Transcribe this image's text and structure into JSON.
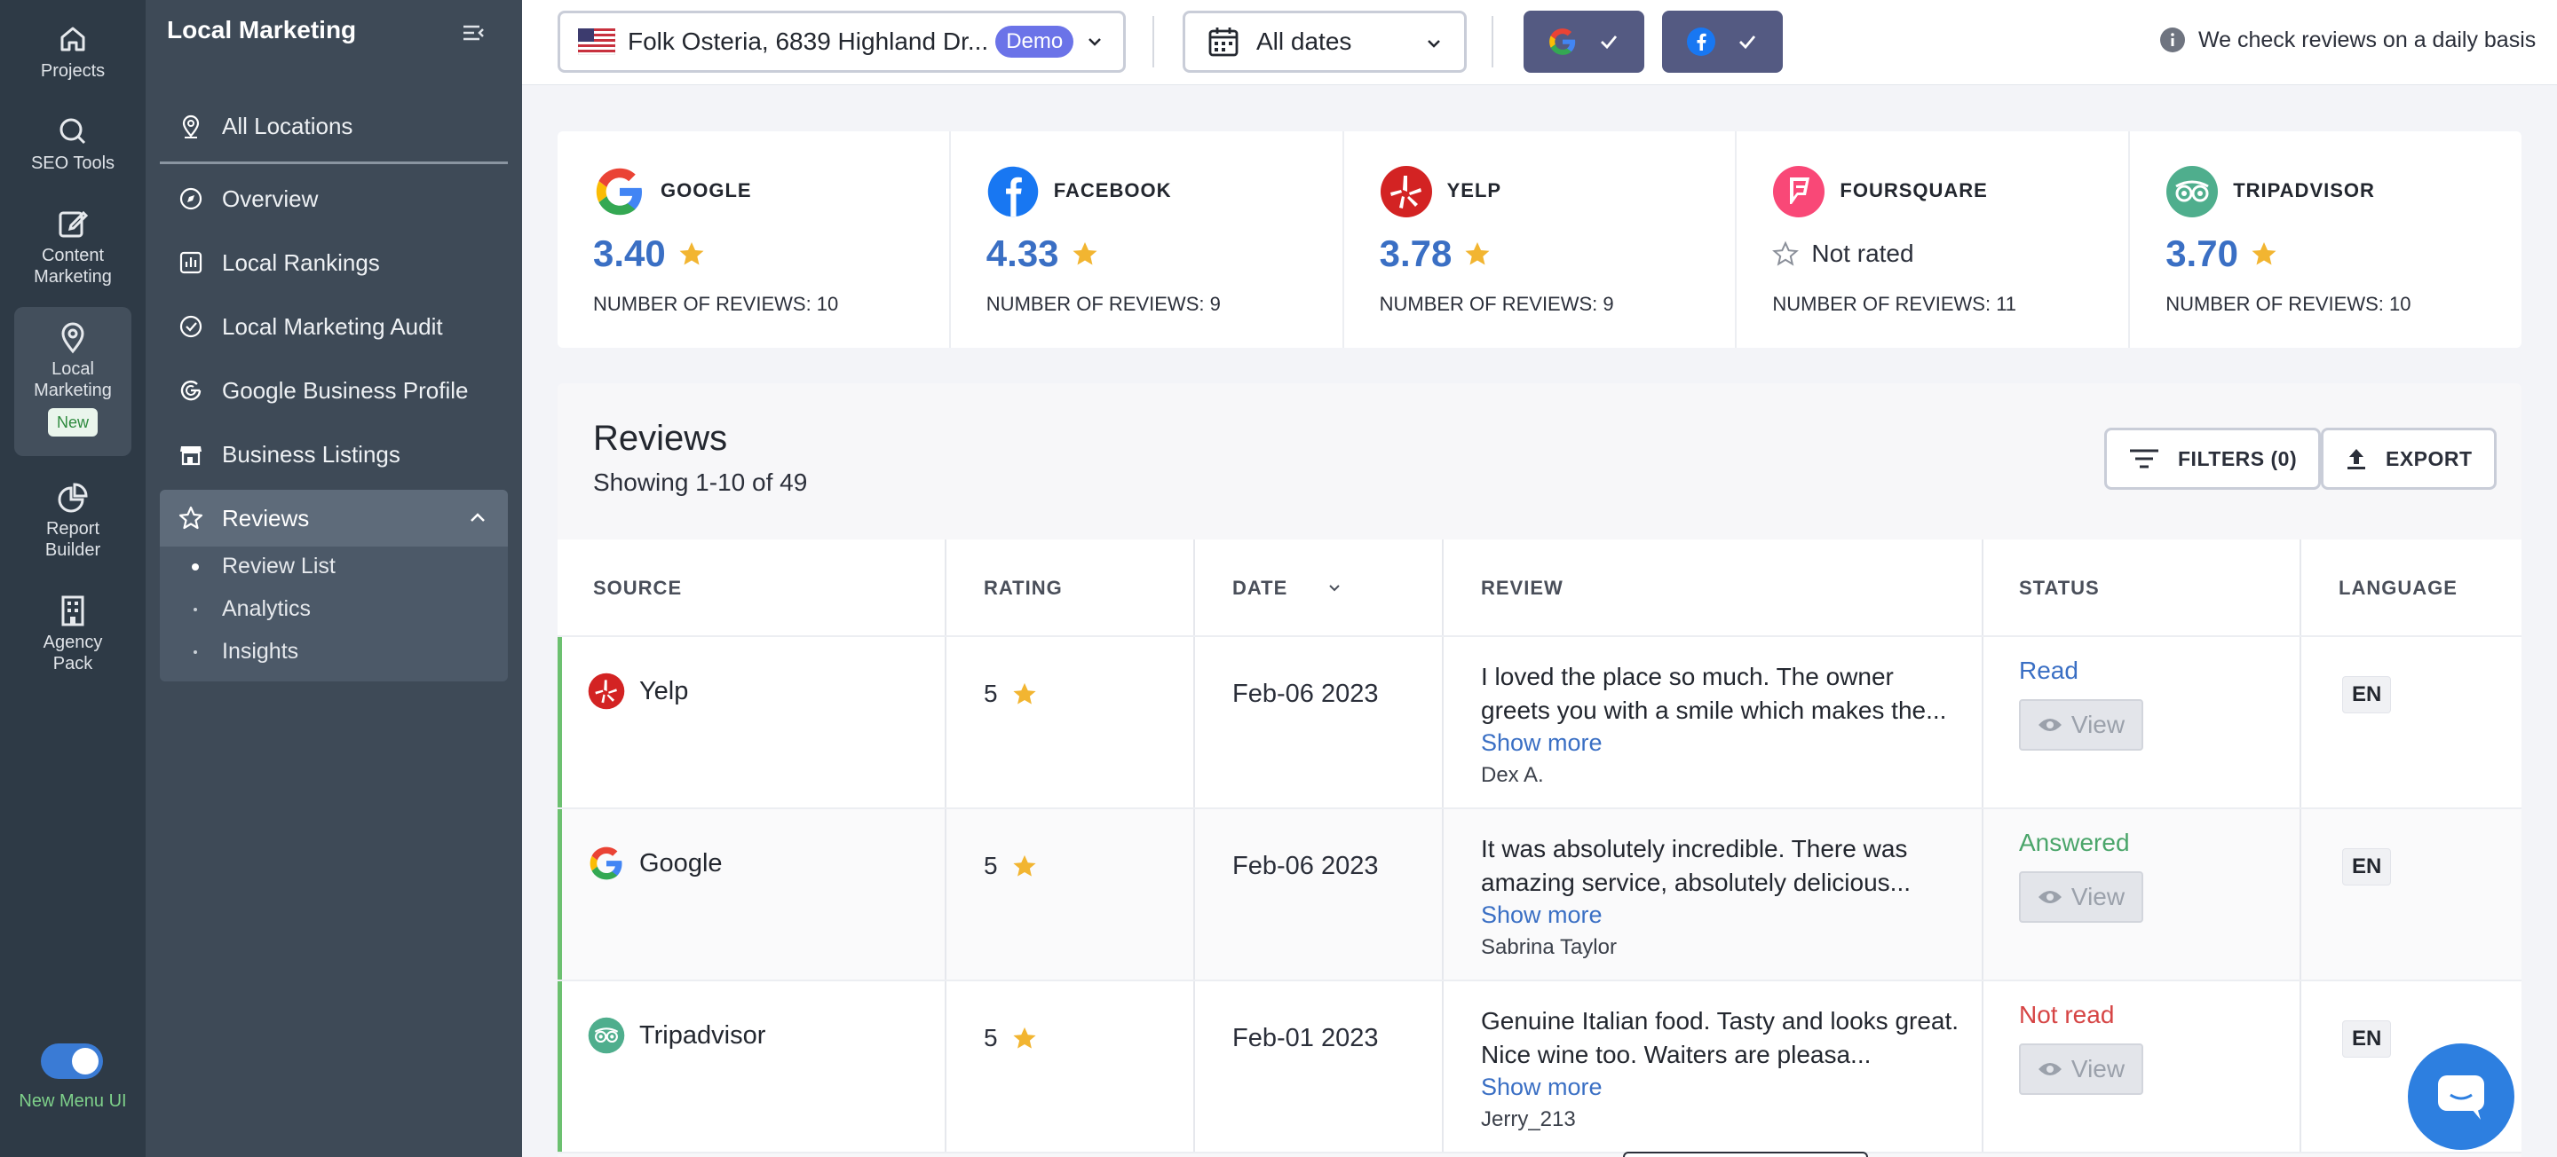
{
  "rail": {
    "items": [
      {
        "label": "Projects",
        "icon": "home-icon"
      },
      {
        "label": "SEO Tools",
        "icon": "search-icon"
      },
      {
        "label": "Content Marketing",
        "icon": "edit-icon"
      },
      {
        "label": "Local Marketing",
        "icon": "location-pin-icon",
        "badge": "New"
      },
      {
        "label": "Report Builder",
        "icon": "pie-chart-icon"
      },
      {
        "label": "Agency Pack",
        "icon": "building-icon"
      }
    ],
    "toggle_label": "New Menu UI"
  },
  "sidebar": {
    "title": "Local Marketing",
    "items": [
      {
        "label": "All Locations"
      },
      {
        "label": "Overview"
      },
      {
        "label": "Local Rankings"
      },
      {
        "label": "Local Marketing Audit"
      },
      {
        "label": "Google Business Profile"
      },
      {
        "label": "Business Listings"
      }
    ],
    "reviews": {
      "label": "Reviews",
      "sub": [
        "Review List",
        "Analytics",
        "Insights"
      ]
    }
  },
  "topbar": {
    "location": "Folk Osteria, 6839 Highland Dr...",
    "demo_badge": "Demo",
    "dates": "All dates",
    "info": "We check reviews on a daily basis"
  },
  "stats": [
    {
      "name": "GOOGLE",
      "rating": "3.40",
      "count": "NUMBER OF REVIEWS: 10"
    },
    {
      "name": "FACEBOOK",
      "rating": "4.33",
      "count": "NUMBER OF REVIEWS: 9"
    },
    {
      "name": "YELP",
      "rating": "3.78",
      "count": "NUMBER OF REVIEWS: 9"
    },
    {
      "name": "FOURSQUARE",
      "rating": "Not rated",
      "count": "NUMBER OF REVIEWS: 11"
    },
    {
      "name": "TRIPADVISOR",
      "rating": "3.70",
      "count": "NUMBER OF REVIEWS: 10"
    }
  ],
  "reviews": {
    "title": "Reviews",
    "showing": "Showing 1-10 of 49",
    "filters_label": "FILTERS (0)",
    "export_label": "EXPORT",
    "columns": [
      "SOURCE",
      "RATING",
      "DATE",
      "REVIEW",
      "STATUS",
      "LANGUAGE"
    ],
    "rows": [
      {
        "source": "Yelp",
        "rating": "5",
        "date": "Feb-06 2023",
        "text": "I loved the place so much. The owner greets you with a smile which makes the...",
        "more": "Show more",
        "author": "Dex A.",
        "status": "Read",
        "view": "View",
        "lang": "EN"
      },
      {
        "source": "Google",
        "rating": "5",
        "date": "Feb-06 2023",
        "text": "It was absolutely incredible. There was amazing service, absolutely delicious...",
        "more": "Show more",
        "author": "Sabrina Taylor",
        "status": "Answered",
        "view": "View",
        "lang": "EN"
      },
      {
        "source": "Tripadvisor",
        "rating": "5",
        "date": "Feb-01 2023",
        "text": "Genuine Italian food. Tasty and looks great. Nice wine too. Waiters are pleasa...",
        "more": "Show more",
        "author": "Jerry_213",
        "status": "Not read",
        "view": "View",
        "lang": "EN"
      }
    ]
  },
  "colors": {
    "accent": "#3a6fc4",
    "read": "#3a6fc4",
    "answered": "#4aa56a",
    "not_read": "#d64545",
    "star": "#f2b531"
  }
}
